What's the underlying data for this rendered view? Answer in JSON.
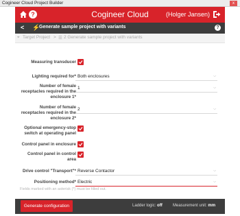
{
  "window": {
    "title": "Cogineer Cloud Project Builder",
    "close_label": "x"
  },
  "header": {
    "title": "Cogineer Cloud",
    "user": "(Holger Jansen)"
  },
  "subheader": {
    "title": "Generate sample project with variants"
  },
  "breadcrumb": {
    "root": "Target Project",
    "separator": ">",
    "current": "2 Generate sample project with variants"
  },
  "form": {
    "measuring_transducer": {
      "label": "Measuring transducer",
      "checked": true
    },
    "lighting": {
      "label": "Lighting required for*",
      "value": "Both enclosures"
    },
    "sockets1": {
      "label": "Number of female receptacles required in the enclosure 1*",
      "value": "1"
    },
    "sockets2": {
      "label": "Number of female receptacles required in the enclosure 2*",
      "value": "2"
    },
    "emergency_stop": {
      "label": "Optional emergency-stop switch at operating panel",
      "checked": true
    },
    "control_panel_enclosure": {
      "label": "Control panel in enclosure",
      "checked": true
    },
    "control_panel_area": {
      "label": "Control panel in control area",
      "checked": true
    },
    "drive_control": {
      "label": "Drive control \"Transport\"*",
      "value": "Reverse Contactor"
    },
    "positioning": {
      "label": "Positioning method*",
      "value": "Electric"
    },
    "hint": "Fields marked with an asterisk (*) must be filled out."
  },
  "footer": {
    "generate_label": "Generate configuration",
    "ladder_label": "Ladder logic:",
    "ladder_value": "off",
    "unit_label": "Measurement unit:",
    "unit_value": "mm"
  },
  "colors": {
    "accent": "#d8232a",
    "dark": "#3d3d3d"
  }
}
